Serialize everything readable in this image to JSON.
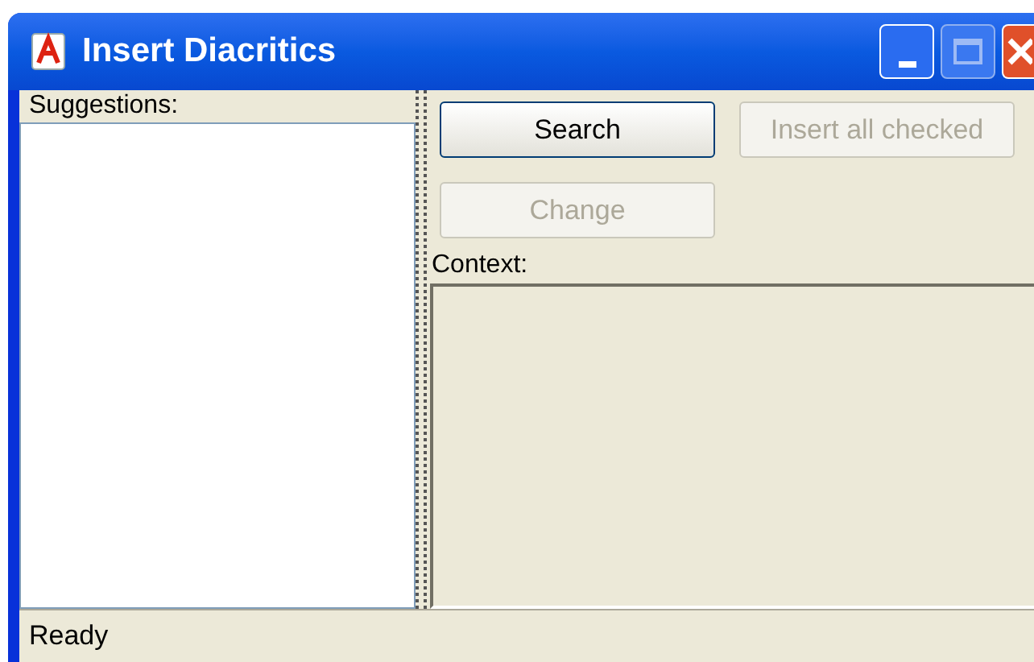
{
  "window": {
    "title": "Insert Diacritics"
  },
  "suggestions": {
    "label": "Suggestions:"
  },
  "buttons": [
    {
      "label": "Search",
      "disabled": false
    },
    {
      "label": "Insert all checked",
      "disabled": true
    },
    {
      "label": "Change",
      "disabled": true
    }
  ],
  "context": {
    "label": "Context:"
  },
  "status_bar": {
    "text": "Ready"
  }
}
